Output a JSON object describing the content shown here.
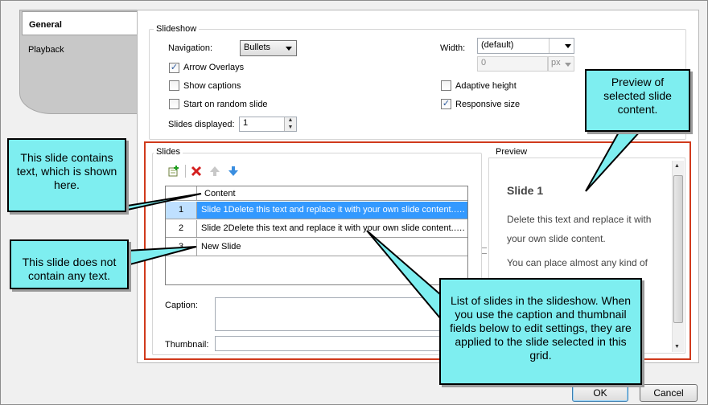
{
  "tabs": [
    {
      "label": "General",
      "selected": true
    },
    {
      "label": "Playback",
      "selected": false
    }
  ],
  "slideshow": {
    "legend": "Slideshow",
    "navigation_label": "Navigation:",
    "navigation_value": "Bullets",
    "arrow_overlays_label": "Arrow Overlays",
    "arrow_overlays_checked": true,
    "show_captions_label": "Show captions",
    "show_captions_checked": false,
    "random_label": "Start on random slide",
    "random_checked": false,
    "slides_displayed_label": "Slides displayed:",
    "slides_displayed_value": "1",
    "width_label": "Width:",
    "width_value": "(default)",
    "width_number": "0",
    "width_unit": "px",
    "adaptive_label": "Adaptive height",
    "adaptive_checked": false,
    "responsive_label": "Responsive size",
    "responsive_checked": true
  },
  "slides": {
    "legend": "Slides",
    "column_header": "Content",
    "rows": [
      {
        "num": "1",
        "content": "Slide 1Delete this text and replace it with your own slide content.….",
        "selected": true
      },
      {
        "num": "2",
        "content": "Slide 2Delete this text and replace it with your own slide content.….",
        "selected": false
      },
      {
        "num": "3",
        "content": "New Slide",
        "selected": false
      }
    ],
    "caption_label": "Caption:",
    "caption_value": "",
    "thumbnail_label": "Thumbnail:",
    "thumbnail_value": ""
  },
  "preview": {
    "legend": "Preview",
    "heading": "Slide 1",
    "para1": "Delete this text and replace it with your own slide content.",
    "para2": "You can place almost any kind of content into a slide, including"
  },
  "callouts": {
    "text_slide": "This slide contains text, which is shown here.",
    "no_text_slide": "This slide does not contain any text.",
    "preview": "Preview of selected slide content.",
    "list": "List of slides in the slideshow. When you use the caption and thumbnail fields below to edit settings, they are applied to the slide selected in this grid."
  },
  "buttons": {
    "ok": "OK",
    "cancel": "Cancel"
  },
  "colors": {
    "highlight": "#3399ff",
    "callout_fill": "#7eeef0",
    "red_outline": "#d03a1c"
  },
  "icons": [
    "add-slide-icon",
    "delete-icon",
    "move-up-icon",
    "move-down-icon"
  ]
}
